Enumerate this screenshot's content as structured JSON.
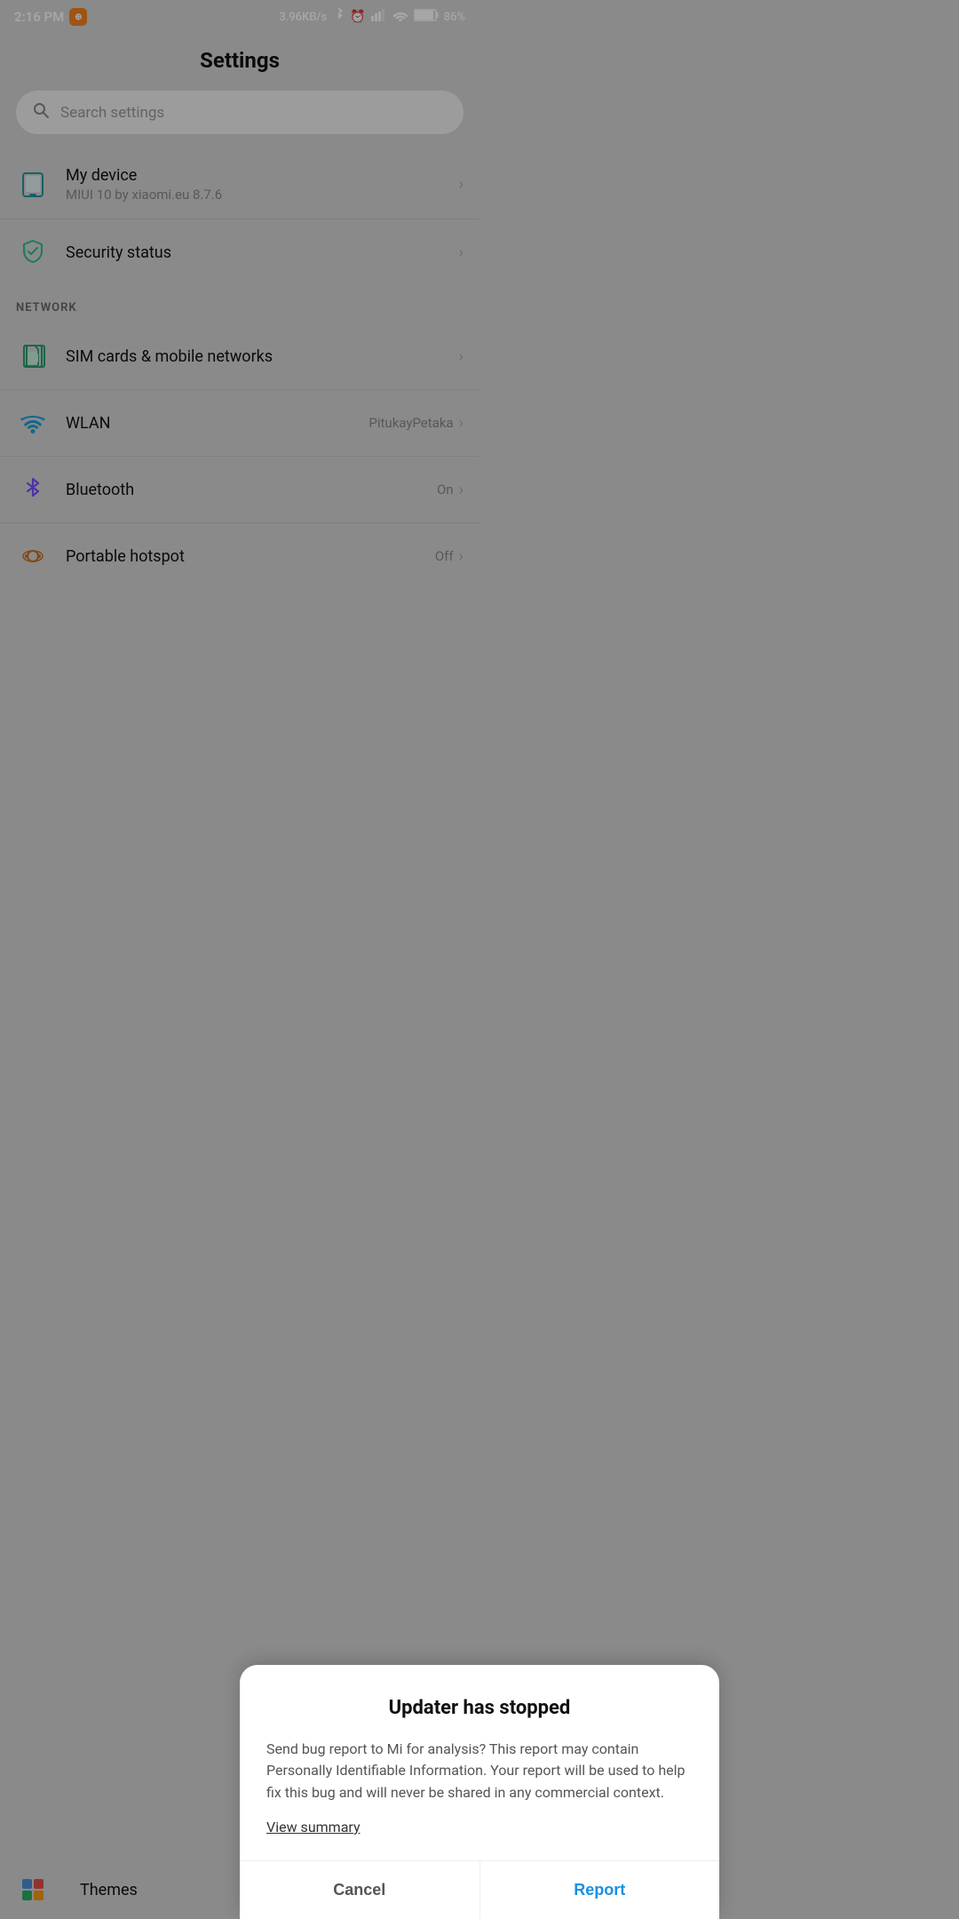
{
  "statusBar": {
    "time": "2:16 PM",
    "speed": "3.96KB/s",
    "battery": "86%"
  },
  "header": {
    "title": "Settings"
  },
  "search": {
    "placeholder": "Search settings"
  },
  "sections": [
    {
      "items": [
        {
          "id": "my-device",
          "title": "My device",
          "subtitle": "MIUI 10 by xiaomi.eu 8.7.6",
          "icon": "device"
        },
        {
          "id": "security-status",
          "title": "Security status",
          "subtitle": "",
          "icon": "shield"
        }
      ]
    },
    {
      "label": "NETWORK",
      "items": [
        {
          "id": "sim-cards",
          "title": "SIM cards & mobile networks",
          "subtitle": "",
          "icon": "sim"
        },
        {
          "id": "wlan",
          "title": "WLAN",
          "subtitle": "PitukayPetaka",
          "icon": "wifi"
        },
        {
          "id": "bluetooth",
          "title": "Bluetooth",
          "subtitle": "On",
          "icon": "bluetooth"
        },
        {
          "id": "hotspot",
          "title": "Portable hotspot",
          "subtitle": "Off",
          "icon": "hotspot"
        }
      ]
    }
  ],
  "bottomPeek": {
    "title": "Themes",
    "icon": "themes"
  },
  "dialog": {
    "title": "Updater has stopped",
    "body": "Send bug report to Mi for analysis? This report may contain Personally Identifiable Information. Your report will be used to help fix this bug and will never be shared in any commercial context.",
    "linkText": "View summary",
    "cancelLabel": "Cancel",
    "reportLabel": "Report"
  }
}
